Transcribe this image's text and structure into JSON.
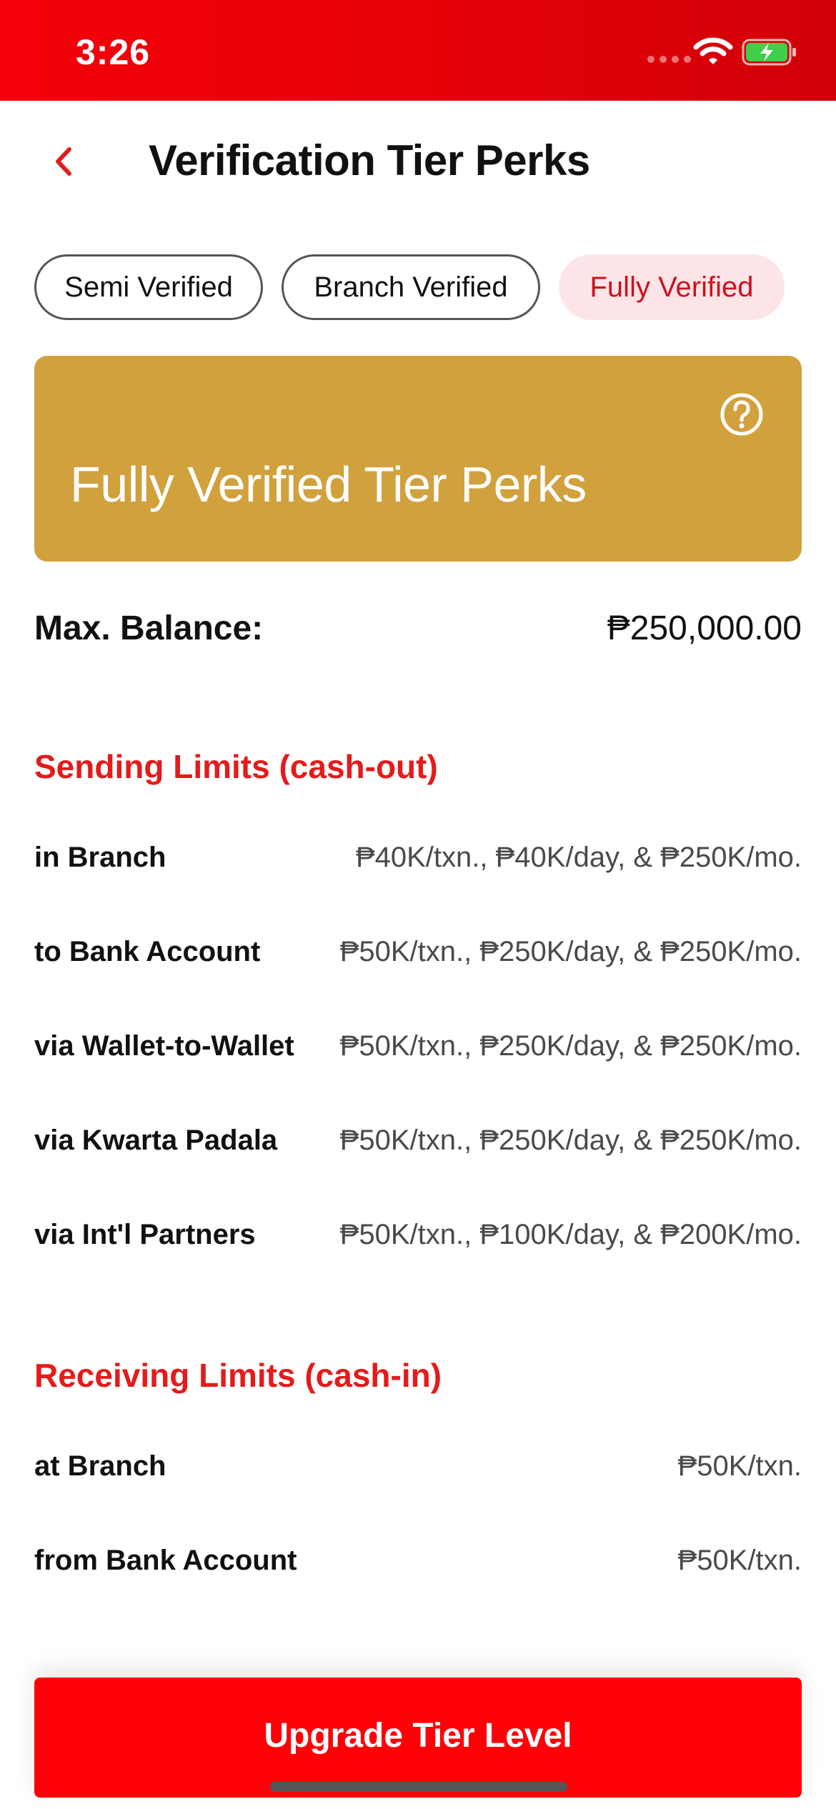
{
  "status_bar": {
    "time": "3:26",
    "accent_color": "#e30008"
  },
  "header": {
    "title": "Verification Tier Perks",
    "back_icon": "chevron-left-icon"
  },
  "tabs": [
    {
      "label": "Semi Verified",
      "active": false
    },
    {
      "label": "Branch Verified",
      "active": false
    },
    {
      "label": "Fully Verified",
      "active": true
    }
  ],
  "banner": {
    "title": "Fully Verified Tier Perks",
    "color": "#d1a13e",
    "help_icon": "question-circle-icon"
  },
  "max_balance": {
    "label": "Max. Balance:",
    "value": "₱250,000.00"
  },
  "sending": {
    "title": "Sending Limits (cash-out)",
    "rows": [
      {
        "label": "in Branch",
        "value": "₱40K/txn., ₱40K/day, & ₱250K/mo."
      },
      {
        "label": "to Bank Account",
        "value": "₱50K/txn., ₱250K/day, & ₱250K/mo."
      },
      {
        "label": "via Wallet-to-Wallet",
        "value": "₱50K/txn., ₱250K/day, & ₱250K/mo."
      },
      {
        "label": "via Kwarta Padala",
        "value": "₱50K/txn., ₱250K/day, & ₱250K/mo."
      },
      {
        "label": "via Int'l Partners",
        "value": "₱50K/txn., ₱100K/day, & ₱200K/mo."
      }
    ]
  },
  "receiving": {
    "title": "Receiving Limits (cash-in)",
    "rows": [
      {
        "label": "at Branch",
        "value": "₱50K/txn."
      },
      {
        "label": "from Bank Account",
        "value": "₱50K/txn."
      }
    ]
  },
  "footer": {
    "button_label": "Upgrade Tier Level",
    "button_color": "#ff0007"
  }
}
